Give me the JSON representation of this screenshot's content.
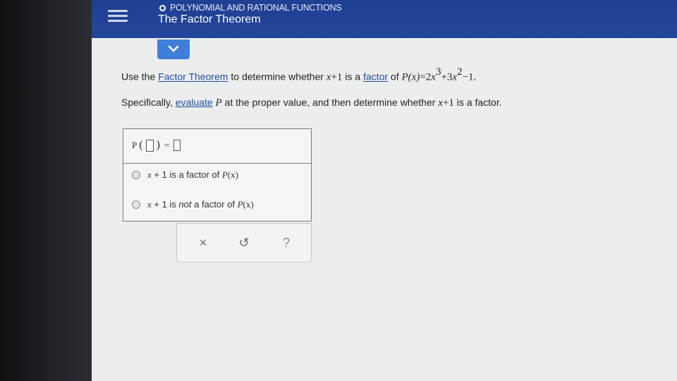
{
  "header": {
    "breadcrumb": "POLYNOMIAL AND RATIONAL FUNCTIONS",
    "title": "The Factor Theorem"
  },
  "question": {
    "line1": {
      "pre": "Use the ",
      "link1": "Factor Theorem",
      "mid": " to determine whether ",
      "expr1_var": "x",
      "expr1_rest": "+1",
      "mid2": " is a ",
      "link2": "factor",
      "mid3": " of ",
      "poly_lhs": "P",
      "poly_lhs_var": "(x)",
      "eq": "=2",
      "t1_var": "x",
      "t1_exp": "3",
      "t2_pre": "+3",
      "t2_var": "x",
      "t2_exp": "2",
      "tail": "−1."
    },
    "line2": {
      "pre": "Specifically, ",
      "link": "evaluate",
      "mid_var": " P",
      "mid": " at the proper value, and then determine whether ",
      "expr_var": "x",
      "expr_rest": "+1",
      "tail": " is a factor."
    }
  },
  "answer": {
    "eq_p": "P",
    "eq_equals": "=",
    "option1": {
      "var": "x",
      "rest1": " + 1 is a factor of ",
      "p": "P",
      "px": "(x)"
    },
    "option2": {
      "var": "x",
      "rest1": " + 1 is ",
      "not": "not",
      "rest2": " a factor of ",
      "p": "P",
      "px": "(x)"
    }
  },
  "toolbar": {
    "clear_icon": "×",
    "undo_icon": "↺",
    "help_icon": "?"
  },
  "colors": {
    "header": "#23469c",
    "link": "#1f4fa3",
    "collapse_tab": "#3f7fd9"
  }
}
